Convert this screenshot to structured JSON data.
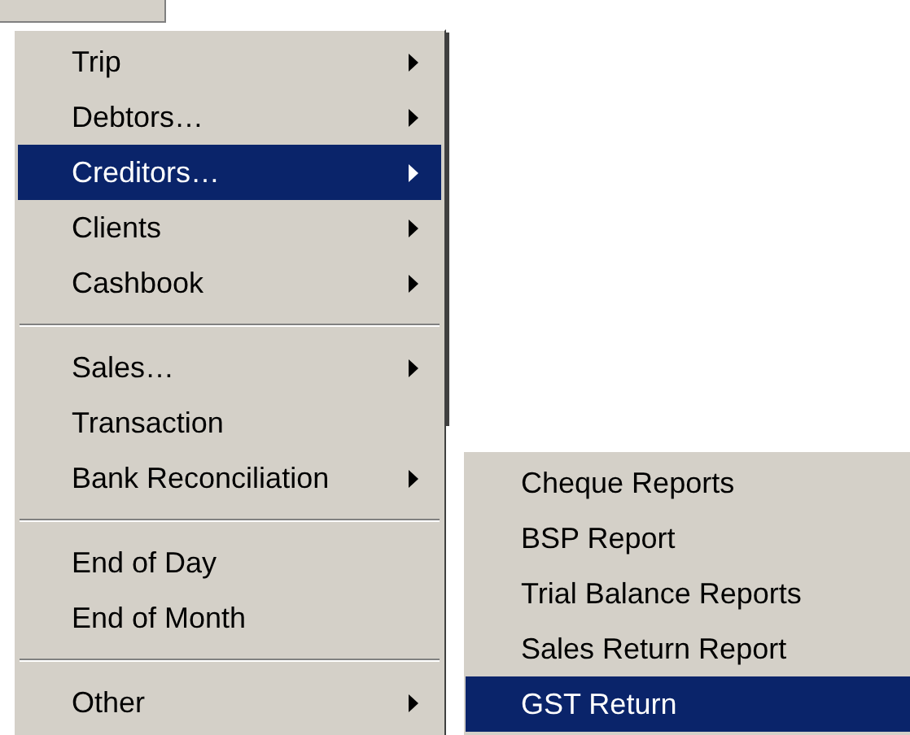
{
  "menu": {
    "items": [
      {
        "kind": "item",
        "label": "Trip",
        "has_submenu": true,
        "selected": false
      },
      {
        "kind": "item",
        "label": "Debtors…",
        "has_submenu": true,
        "selected": false
      },
      {
        "kind": "item",
        "label": "Creditors…",
        "has_submenu": true,
        "selected": true
      },
      {
        "kind": "item",
        "label": "Clients",
        "has_submenu": true,
        "selected": false
      },
      {
        "kind": "item",
        "label": "Cashbook",
        "has_submenu": true,
        "selected": false
      },
      {
        "kind": "separator"
      },
      {
        "kind": "item",
        "label": "Sales…",
        "has_submenu": true,
        "selected": false
      },
      {
        "kind": "item",
        "label": "Transaction",
        "has_submenu": false,
        "selected": false
      },
      {
        "kind": "item",
        "label": "Bank Reconciliation",
        "has_submenu": true,
        "selected": false
      },
      {
        "kind": "separator"
      },
      {
        "kind": "item",
        "label": "End of Day",
        "has_submenu": false,
        "selected": false
      },
      {
        "kind": "item",
        "label": "End of Month",
        "has_submenu": false,
        "selected": false
      },
      {
        "kind": "separator"
      },
      {
        "kind": "item",
        "label": "Other",
        "has_submenu": true,
        "selected": false
      }
    ]
  },
  "submenu": {
    "items": [
      {
        "label": "Cheque Reports",
        "selected": false
      },
      {
        "label": "BSP Report",
        "selected": false
      },
      {
        "label": "Trial Balance Reports",
        "selected": false
      },
      {
        "label": "Sales Return Report",
        "selected": false
      },
      {
        "label": "GST Return",
        "selected": true
      }
    ]
  }
}
